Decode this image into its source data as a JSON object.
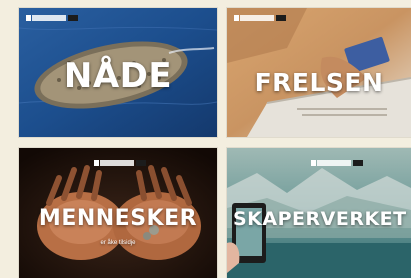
{
  "tiles": [
    {
      "title": "NÅDE",
      "subtitle": ""
    },
    {
      "title": "FRELSEN",
      "subtitle": ""
    },
    {
      "title": "MENNESKER",
      "subtitle": "er åke tilsidje"
    },
    {
      "title": "SKAPERVERKET",
      "subtitle": ""
    }
  ],
  "colors": {
    "page_background": "#f3eedf",
    "title_text": "#ffffff",
    "ocean_blue": "#1d4f8c",
    "glacier_teal": "#4e8f92"
  },
  "icons": [
    "magazine-badge-icon",
    "boat-crowd-image",
    "laptop-card-image",
    "hands-coins-image",
    "tablet-glacier-image"
  ]
}
